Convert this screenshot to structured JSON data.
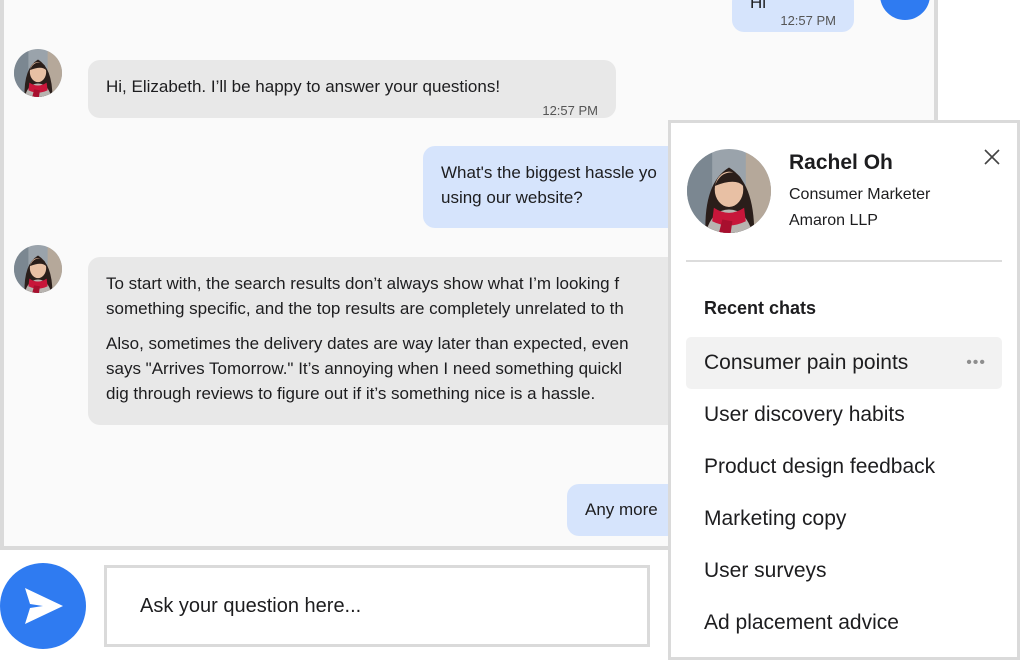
{
  "colors": {
    "accent": "#2f7bf1",
    "bot_bubble": "#e8e8e8",
    "user_bubble": "#d6e4fc",
    "border": "#dadada"
  },
  "conversation": {
    "messages": [
      {
        "sender": "user",
        "text": "Hi",
        "time": "12:57 PM"
      },
      {
        "sender": "bot",
        "text": "Hi, Elizabeth. I’ll be happy to answer your questions!",
        "time": "12:57 PM"
      },
      {
        "sender": "user",
        "lines": [
          "What's the biggest hassle yo",
          "using our website?"
        ]
      },
      {
        "sender": "bot",
        "paragraphs": [
          [
            "To start with, the search results don’t always show what I’m looking f",
            "something specific, and the top results are completely unrelated to th"
          ],
          [
            "Also, sometimes the delivery dates are way later than expected, even",
            "says \"Arrives Tomorrow.\" It’s annoying when I need something quickl",
            "dig through reviews to figure out if it’s something nice is a hassle."
          ]
        ]
      },
      {
        "sender": "user",
        "text": "Any more"
      }
    ]
  },
  "composer": {
    "placeholder": "Ask your question here...",
    "send_icon": "send-icon"
  },
  "profile": {
    "name": "Rachel Oh",
    "role": "Consumer Marketer",
    "company": "Amaron LLP",
    "close_icon": "close-icon"
  },
  "recent_chats": {
    "title": "Recent chats",
    "items": [
      {
        "label": "Consumer pain points",
        "active": true,
        "more": "•••"
      },
      {
        "label": "User discovery habits"
      },
      {
        "label": "Product design feedback"
      },
      {
        "label": "Marketing copy"
      },
      {
        "label": "User surveys"
      },
      {
        "label": "Ad placement advice"
      }
    ]
  }
}
